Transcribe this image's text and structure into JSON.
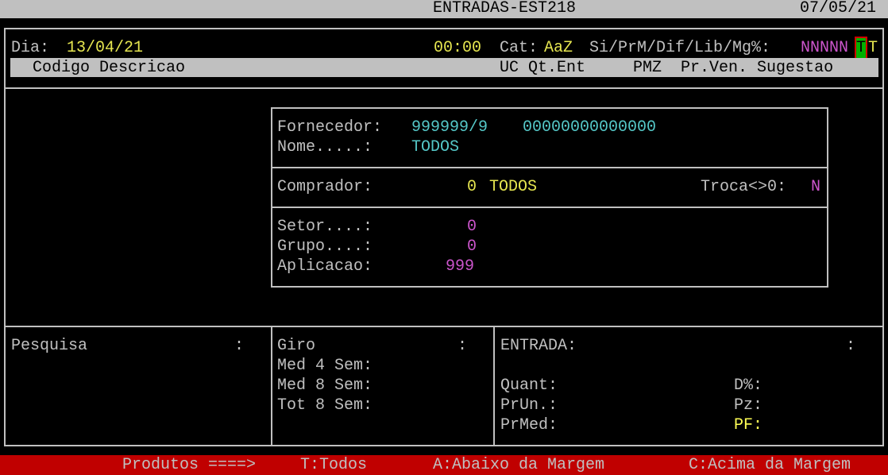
{
  "window": {
    "title": "ENTRADAS-EST218",
    "date": "07/05/21"
  },
  "top": {
    "dia_label": "Dia:",
    "dia_value": "13/04/21",
    "time": "00:00",
    "cat_label": "Cat:",
    "cat_value": "AaZ",
    "flags_label": "Si/PrM/Dif/Lib/Mg%:",
    "flags_magenta": "NNNNN",
    "flag_cursor": "T",
    "flag_last": "T"
  },
  "columns": {
    "left": "Codigo Descricao",
    "right": "UC Qt.Ent     PMZ  Pr.Ven. Sugestao"
  },
  "filter": {
    "fornecedor_label": "Fornecedor:",
    "fornecedor_code": "999999/9",
    "fornecedor_cnpj": "00000000000000",
    "nome_label": "Nome.....:",
    "nome_value": "TODOS",
    "comprador_label": "Comprador:",
    "comprador_code": "0",
    "comprador_value": "TODOS",
    "troca_label": "Troca<>0:",
    "troca_value": "N",
    "setor_label": "Setor....:",
    "setor_value": "0",
    "grupo_label": "Grupo....:",
    "grupo_value": "0",
    "aplicacao_label": "Aplicacao:",
    "aplicacao_value": "999"
  },
  "bottom": {
    "pesquisa_label": "Pesquisa",
    "pesquisa_colon": ":",
    "giro_label": "Giro",
    "giro_colon": ":",
    "med4_label": "Med 4 Sem:",
    "med8_label": "Med 8 Sem:",
    "tot8_label": "Tot 8 Sem:",
    "entrada_label": "ENTRADA:",
    "entrada_colon": ":",
    "quant_label": "Quant:",
    "prun_label": "PrUn.:",
    "prmed_label": "PrMed:",
    "dpct_label": "D%:",
    "pz_label": "Pz:",
    "pf_label": "PF:"
  },
  "footer": {
    "produtos": "Produtos ====>",
    "todos": "T:Todos",
    "abaixo": "A:Abaixo da Margem",
    "acima": "C:Acima da Margem"
  },
  "colors": {
    "background": "#000000",
    "text": "#c0c0c0",
    "cyan": "#55c8c8",
    "yellow": "#e6e650",
    "magenta": "#cc55cc",
    "footer_bg": "#c00000",
    "cursor_bg": "#00b000"
  }
}
